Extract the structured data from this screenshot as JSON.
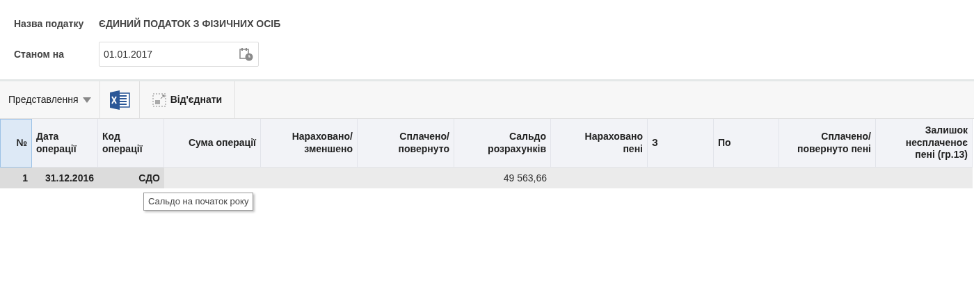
{
  "form": {
    "fields": [
      {
        "label": "Назва податку",
        "kind": "text",
        "value": "ЄДИНИЙ ПОДАТОК З ФІЗИЧНИХ ОСІБ"
      },
      {
        "label": "Станом на",
        "kind": "date",
        "value": "01.01.2017"
      }
    ]
  },
  "toolbar": {
    "view_menu": "Представлення",
    "detach_button": "Від'єднати"
  },
  "table": {
    "columns": [
      {
        "label": "№",
        "selected": true
      },
      {
        "label": "Дата\nоперації",
        "selected": false
      },
      {
        "label": "Код\nоперації",
        "selected": false
      },
      {
        "label": "Сума операції",
        "selected": false
      },
      {
        "label": "Нараховано/\nзменшено",
        "selected": false
      },
      {
        "label": "Сплачено/\nповернуто",
        "selected": false
      },
      {
        "label": "Сальдо\nрозрахунків",
        "selected": false
      },
      {
        "label": "Нараховано\nпені",
        "selected": false
      },
      {
        "label": "З",
        "selected": false
      },
      {
        "label": "По",
        "selected": false
      },
      {
        "label": "Сплачено/\nповернуто пені",
        "selected": false
      },
      {
        "label": "Залишок\nнесплаченоє\nпені (гр.13)",
        "selected": false
      }
    ],
    "rows": [
      {
        "selected": true,
        "cells": [
          "1",
          "31.12.2016",
          "СДО",
          "",
          "",
          "",
          "49 563,66",
          "",
          "",
          "",
          "",
          ""
        ]
      }
    ]
  },
  "tooltip": "Сальдо на початок року"
}
